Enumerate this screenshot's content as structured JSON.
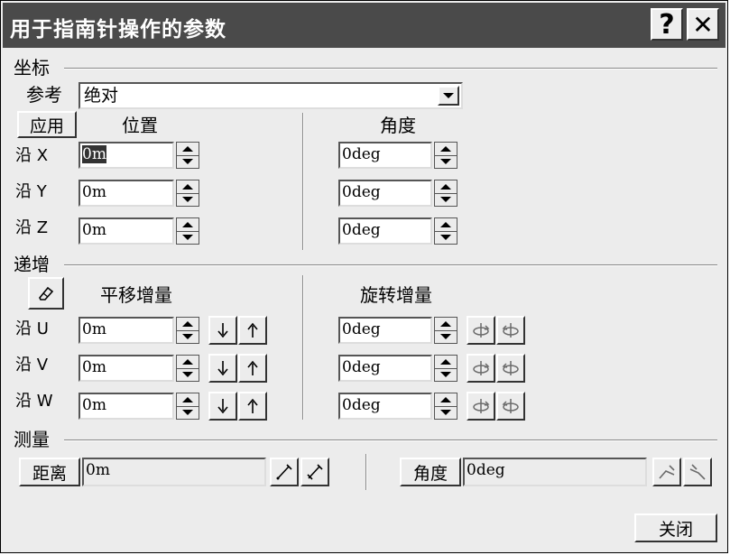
{
  "window": {
    "title": "用于指南针操作的参数",
    "help_label": "?",
    "close_label": "✕"
  },
  "coords": {
    "section": "坐标",
    "ref_label": "参考",
    "ref_value": "绝对",
    "apply_label": "应用",
    "pos_header": "位置",
    "ang_header": "角度",
    "rows": [
      {
        "label": "沿 X",
        "pos": "0m",
        "ang": "0deg"
      },
      {
        "label": "沿 Y",
        "pos": "0m",
        "ang": "0deg"
      },
      {
        "label": "沿 Z",
        "pos": "0m",
        "ang": "0deg"
      }
    ]
  },
  "increment": {
    "section": "递增",
    "trans_header": "平移增量",
    "rot_header": "旋转增量",
    "rows": [
      {
        "label": "沿 U",
        "trans": "0m",
        "rot": "0deg"
      },
      {
        "label": "沿 V",
        "trans": "0m",
        "rot": "0deg"
      },
      {
        "label": "沿 W",
        "trans": "0m",
        "rot": "0deg"
      }
    ]
  },
  "measure": {
    "section": "测量",
    "distance_label": "距离",
    "distance_value": "0m",
    "angle_label": "角度",
    "angle_value": "0deg"
  },
  "footer": {
    "close_label": "关闭"
  },
  "icons": {
    "eraser": "eraser-icon",
    "down": "arrow-down-icon",
    "up": "arrow-up-icon",
    "rotate_cw": "rotate-forward-icon",
    "rotate_ccw": "rotate-back-icon",
    "measure_dist": "measure-distance-icon",
    "measure_ang": "measure-angle-icon"
  }
}
